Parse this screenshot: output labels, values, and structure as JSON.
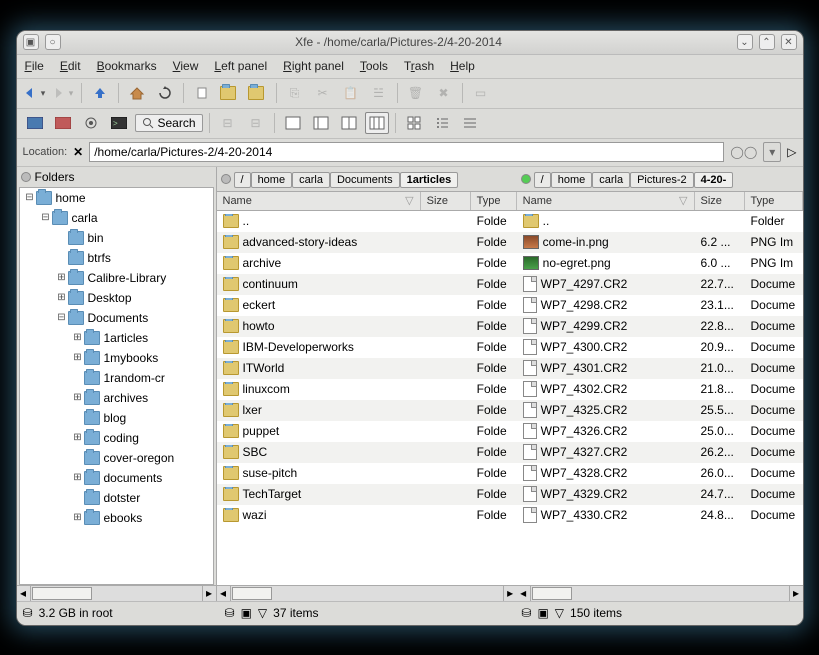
{
  "window": {
    "title": "Xfe - /home/carla/Pictures-2/4-20-2014"
  },
  "menu": {
    "file": "File",
    "edit": "Edit",
    "bookmarks": "Bookmarks",
    "view": "View",
    "leftpanel": "Left panel",
    "rightpanel": "Right panel",
    "tools": "Tools",
    "trash": "Trash",
    "help": "Help"
  },
  "toolbar2": {
    "search_label": "Search"
  },
  "location": {
    "label": "Location:",
    "value": "/home/carla/Pictures-2/4-20-2014"
  },
  "tree": {
    "header": "Folders",
    "items": [
      {
        "indent": 0,
        "exp": "-",
        "label": "home"
      },
      {
        "indent": 1,
        "exp": "-",
        "label": "carla"
      },
      {
        "indent": 2,
        "exp": "",
        "label": "bin"
      },
      {
        "indent": 2,
        "exp": "",
        "label": "btrfs"
      },
      {
        "indent": 2,
        "exp": "+",
        "label": "Calibre-Library"
      },
      {
        "indent": 2,
        "exp": "+",
        "label": "Desktop"
      },
      {
        "indent": 2,
        "exp": "-",
        "label": "Documents"
      },
      {
        "indent": 3,
        "exp": "+",
        "label": "1articles"
      },
      {
        "indent": 3,
        "exp": "+",
        "label": "1mybooks"
      },
      {
        "indent": 3,
        "exp": "",
        "label": "1random-cr"
      },
      {
        "indent": 3,
        "exp": "+",
        "label": "archives"
      },
      {
        "indent": 3,
        "exp": "",
        "label": "blog"
      },
      {
        "indent": 3,
        "exp": "+",
        "label": "coding"
      },
      {
        "indent": 3,
        "exp": "",
        "label": "cover-oregon"
      },
      {
        "indent": 3,
        "exp": "+",
        "label": "documents"
      },
      {
        "indent": 3,
        "exp": "",
        "label": "dotster"
      },
      {
        "indent": 3,
        "exp": "+",
        "label": "ebooks"
      }
    ]
  },
  "left_crumbs": [
    "/",
    "home",
    "carla",
    "Documents",
    "1articles"
  ],
  "right_crumbs": [
    "/",
    "home",
    "carla",
    "Pictures-2",
    "4-20-"
  ],
  "columns": {
    "name": "Name",
    "size": "Size",
    "type": "Type"
  },
  "left_files": [
    {
      "icon": "folder-up",
      "name": "..",
      "size": "",
      "type": "Folde"
    },
    {
      "icon": "folder",
      "name": "advanced-story-ideas",
      "size": "",
      "type": "Folde"
    },
    {
      "icon": "folder",
      "name": "archive",
      "size": "",
      "type": "Folde"
    },
    {
      "icon": "folder",
      "name": "continuum",
      "size": "",
      "type": "Folde"
    },
    {
      "icon": "folder",
      "name": "eckert",
      "size": "",
      "type": "Folde"
    },
    {
      "icon": "folder",
      "name": "howto",
      "size": "",
      "type": "Folde"
    },
    {
      "icon": "folder",
      "name": "IBM-Developerworks",
      "size": "",
      "type": "Folde"
    },
    {
      "icon": "folder",
      "name": "ITWorld",
      "size": "",
      "type": "Folde"
    },
    {
      "icon": "folder",
      "name": "linuxcom",
      "size": "",
      "type": "Folde"
    },
    {
      "icon": "folder",
      "name": "lxer",
      "size": "",
      "type": "Folde"
    },
    {
      "icon": "folder",
      "name": "puppet",
      "size": "",
      "type": "Folde"
    },
    {
      "icon": "folder",
      "name": "SBC",
      "size": "",
      "type": "Folde"
    },
    {
      "icon": "folder",
      "name": "suse-pitch",
      "size": "",
      "type": "Folde"
    },
    {
      "icon": "folder",
      "name": "TechTarget",
      "size": "",
      "type": "Folde"
    },
    {
      "icon": "folder",
      "name": "wazi",
      "size": "",
      "type": "Folde"
    }
  ],
  "right_files": [
    {
      "icon": "folder-up",
      "name": "..",
      "size": "",
      "type": "Folder"
    },
    {
      "icon": "img1",
      "name": "come-in.png",
      "size": "6.2 ...",
      "type": "PNG Im"
    },
    {
      "icon": "img2",
      "name": "no-egret.png",
      "size": "6.0 ...",
      "type": "PNG Im"
    },
    {
      "icon": "file",
      "name": "WP7_4297.CR2",
      "size": "22.7...",
      "type": "Docume"
    },
    {
      "icon": "file",
      "name": "WP7_4298.CR2",
      "size": "23.1...",
      "type": "Docume"
    },
    {
      "icon": "file",
      "name": "WP7_4299.CR2",
      "size": "22.8...",
      "type": "Docume"
    },
    {
      "icon": "file",
      "name": "WP7_4300.CR2",
      "size": "20.9...",
      "type": "Docume"
    },
    {
      "icon": "file",
      "name": "WP7_4301.CR2",
      "size": "21.0...",
      "type": "Docume"
    },
    {
      "icon": "file",
      "name": "WP7_4302.CR2",
      "size": "21.8...",
      "type": "Docume"
    },
    {
      "icon": "file",
      "name": "WP7_4325.CR2",
      "size": "25.5...",
      "type": "Docume"
    },
    {
      "icon": "file",
      "name": "WP7_4326.CR2",
      "size": "25.0...",
      "type": "Docume"
    },
    {
      "icon": "file",
      "name": "WP7_4327.CR2",
      "size": "26.2...",
      "type": "Docume"
    },
    {
      "icon": "file",
      "name": "WP7_4328.CR2",
      "size": "26.0...",
      "type": "Docume"
    },
    {
      "icon": "file",
      "name": "WP7_4329.CR2",
      "size": "24.7...",
      "type": "Docume"
    },
    {
      "icon": "file",
      "name": "WP7_4330.CR2",
      "size": "24.8...",
      "type": "Docume"
    }
  ],
  "status": {
    "root": "3.2 GB in root",
    "left_items": "37 items",
    "right_items": "150 items"
  }
}
